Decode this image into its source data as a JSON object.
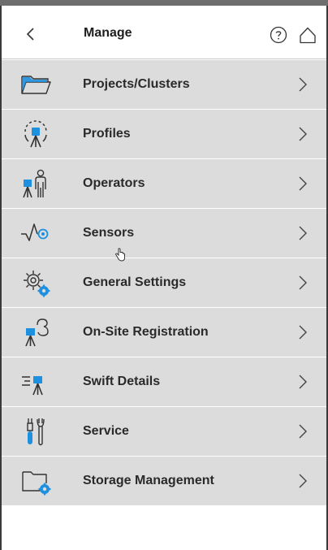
{
  "header": {
    "title": "Manage",
    "back_icon": "chevron-left-icon",
    "help_icon": "help-circle-icon",
    "home_icon": "home-icon"
  },
  "colors": {
    "accent": "#1e90e0",
    "row_background": "#dcdcdc",
    "text": "#2a2a2a"
  },
  "menu": {
    "items": [
      {
        "label": "Projects/Clusters",
        "icon": "folder-icon"
      },
      {
        "label": "Profiles",
        "icon": "profile-scanner-icon"
      },
      {
        "label": "Operators",
        "icon": "operator-icon"
      },
      {
        "label": "Sensors",
        "icon": "sensor-icon"
      },
      {
        "label": "General Settings",
        "icon": "settings-gears-icon"
      },
      {
        "label": "On-Site Registration",
        "icon": "onsite-registration-icon"
      },
      {
        "label": "Swift Details",
        "icon": "swift-details-icon"
      },
      {
        "label": "Service",
        "icon": "service-tools-icon"
      },
      {
        "label": "Storage Management",
        "icon": "storage-folder-icon"
      }
    ]
  }
}
